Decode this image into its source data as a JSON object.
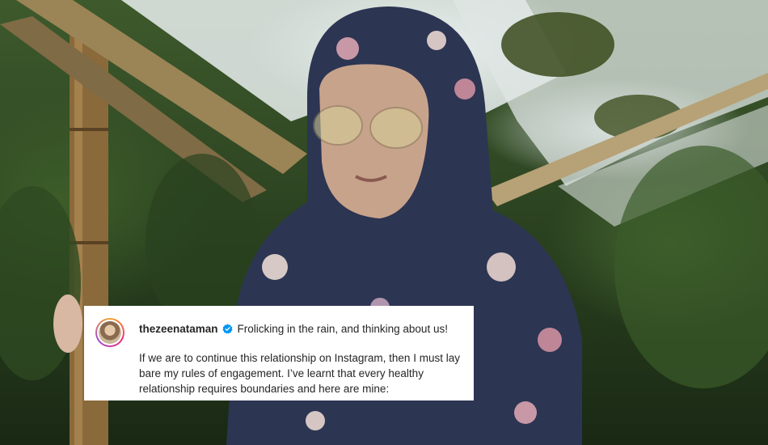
{
  "caption": {
    "username": "thezeenataman",
    "first_line": "Frolicking in the rain, and thinking about us!",
    "body": "If we are to continue this relationship on Instagram, then I must lay bare my rules of engagement. I’ve learnt that every healthy relationship requires boundaries and here are mine:",
    "verified_icon": "verified-badge-icon",
    "verified_color": "#0095f6"
  }
}
